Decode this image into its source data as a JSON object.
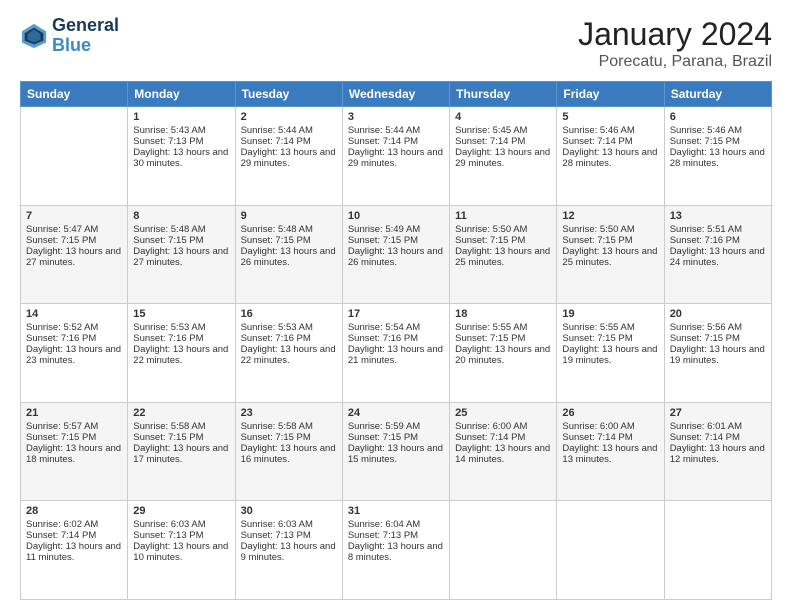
{
  "header": {
    "logo_line1": "General",
    "logo_line2": "Blue",
    "title": "January 2024",
    "subtitle": "Porecatu, Parana, Brazil"
  },
  "days_of_week": [
    "Sunday",
    "Monday",
    "Tuesday",
    "Wednesday",
    "Thursday",
    "Friday",
    "Saturday"
  ],
  "weeks": [
    [
      {
        "day": "",
        "sunrise": "",
        "sunset": "",
        "daylight": ""
      },
      {
        "day": "1",
        "sunrise": "Sunrise: 5:43 AM",
        "sunset": "Sunset: 7:13 PM",
        "daylight": "Daylight: 13 hours and 30 minutes."
      },
      {
        "day": "2",
        "sunrise": "Sunrise: 5:44 AM",
        "sunset": "Sunset: 7:14 PM",
        "daylight": "Daylight: 13 hours and 29 minutes."
      },
      {
        "day": "3",
        "sunrise": "Sunrise: 5:44 AM",
        "sunset": "Sunset: 7:14 PM",
        "daylight": "Daylight: 13 hours and 29 minutes."
      },
      {
        "day": "4",
        "sunrise": "Sunrise: 5:45 AM",
        "sunset": "Sunset: 7:14 PM",
        "daylight": "Daylight: 13 hours and 29 minutes."
      },
      {
        "day": "5",
        "sunrise": "Sunrise: 5:46 AM",
        "sunset": "Sunset: 7:14 PM",
        "daylight": "Daylight: 13 hours and 28 minutes."
      },
      {
        "day": "6",
        "sunrise": "Sunrise: 5:46 AM",
        "sunset": "Sunset: 7:15 PM",
        "daylight": "Daylight: 13 hours and 28 minutes."
      }
    ],
    [
      {
        "day": "7",
        "sunrise": "Sunrise: 5:47 AM",
        "sunset": "Sunset: 7:15 PM",
        "daylight": "Daylight: 13 hours and 27 minutes."
      },
      {
        "day": "8",
        "sunrise": "Sunrise: 5:48 AM",
        "sunset": "Sunset: 7:15 PM",
        "daylight": "Daylight: 13 hours and 27 minutes."
      },
      {
        "day": "9",
        "sunrise": "Sunrise: 5:48 AM",
        "sunset": "Sunset: 7:15 PM",
        "daylight": "Daylight: 13 hours and 26 minutes."
      },
      {
        "day": "10",
        "sunrise": "Sunrise: 5:49 AM",
        "sunset": "Sunset: 7:15 PM",
        "daylight": "Daylight: 13 hours and 26 minutes."
      },
      {
        "day": "11",
        "sunrise": "Sunrise: 5:50 AM",
        "sunset": "Sunset: 7:15 PM",
        "daylight": "Daylight: 13 hours and 25 minutes."
      },
      {
        "day": "12",
        "sunrise": "Sunrise: 5:50 AM",
        "sunset": "Sunset: 7:15 PM",
        "daylight": "Daylight: 13 hours and 25 minutes."
      },
      {
        "day": "13",
        "sunrise": "Sunrise: 5:51 AM",
        "sunset": "Sunset: 7:16 PM",
        "daylight": "Daylight: 13 hours and 24 minutes."
      }
    ],
    [
      {
        "day": "14",
        "sunrise": "Sunrise: 5:52 AM",
        "sunset": "Sunset: 7:16 PM",
        "daylight": "Daylight: 13 hours and 23 minutes."
      },
      {
        "day": "15",
        "sunrise": "Sunrise: 5:53 AM",
        "sunset": "Sunset: 7:16 PM",
        "daylight": "Daylight: 13 hours and 22 minutes."
      },
      {
        "day": "16",
        "sunrise": "Sunrise: 5:53 AM",
        "sunset": "Sunset: 7:16 PM",
        "daylight": "Daylight: 13 hours and 22 minutes."
      },
      {
        "day": "17",
        "sunrise": "Sunrise: 5:54 AM",
        "sunset": "Sunset: 7:16 PM",
        "daylight": "Daylight: 13 hours and 21 minutes."
      },
      {
        "day": "18",
        "sunrise": "Sunrise: 5:55 AM",
        "sunset": "Sunset: 7:15 PM",
        "daylight": "Daylight: 13 hours and 20 minutes."
      },
      {
        "day": "19",
        "sunrise": "Sunrise: 5:55 AM",
        "sunset": "Sunset: 7:15 PM",
        "daylight": "Daylight: 13 hours and 19 minutes."
      },
      {
        "day": "20",
        "sunrise": "Sunrise: 5:56 AM",
        "sunset": "Sunset: 7:15 PM",
        "daylight": "Daylight: 13 hours and 19 minutes."
      }
    ],
    [
      {
        "day": "21",
        "sunrise": "Sunrise: 5:57 AM",
        "sunset": "Sunset: 7:15 PM",
        "daylight": "Daylight: 13 hours and 18 minutes."
      },
      {
        "day": "22",
        "sunrise": "Sunrise: 5:58 AM",
        "sunset": "Sunset: 7:15 PM",
        "daylight": "Daylight: 13 hours and 17 minutes."
      },
      {
        "day": "23",
        "sunrise": "Sunrise: 5:58 AM",
        "sunset": "Sunset: 7:15 PM",
        "daylight": "Daylight: 13 hours and 16 minutes."
      },
      {
        "day": "24",
        "sunrise": "Sunrise: 5:59 AM",
        "sunset": "Sunset: 7:15 PM",
        "daylight": "Daylight: 13 hours and 15 minutes."
      },
      {
        "day": "25",
        "sunrise": "Sunrise: 6:00 AM",
        "sunset": "Sunset: 7:14 PM",
        "daylight": "Daylight: 13 hours and 14 minutes."
      },
      {
        "day": "26",
        "sunrise": "Sunrise: 6:00 AM",
        "sunset": "Sunset: 7:14 PM",
        "daylight": "Daylight: 13 hours and 13 minutes."
      },
      {
        "day": "27",
        "sunrise": "Sunrise: 6:01 AM",
        "sunset": "Sunset: 7:14 PM",
        "daylight": "Daylight: 13 hours and 12 minutes."
      }
    ],
    [
      {
        "day": "28",
        "sunrise": "Sunrise: 6:02 AM",
        "sunset": "Sunset: 7:14 PM",
        "daylight": "Daylight: 13 hours and 11 minutes."
      },
      {
        "day": "29",
        "sunrise": "Sunrise: 6:03 AM",
        "sunset": "Sunset: 7:13 PM",
        "daylight": "Daylight: 13 hours and 10 minutes."
      },
      {
        "day": "30",
        "sunrise": "Sunrise: 6:03 AM",
        "sunset": "Sunset: 7:13 PM",
        "daylight": "Daylight: 13 hours and 9 minutes."
      },
      {
        "day": "31",
        "sunrise": "Sunrise: 6:04 AM",
        "sunset": "Sunset: 7:13 PM",
        "daylight": "Daylight: 13 hours and 8 minutes."
      },
      {
        "day": "",
        "sunrise": "",
        "sunset": "",
        "daylight": ""
      },
      {
        "day": "",
        "sunrise": "",
        "sunset": "",
        "daylight": ""
      },
      {
        "day": "",
        "sunrise": "",
        "sunset": "",
        "daylight": ""
      }
    ]
  ]
}
